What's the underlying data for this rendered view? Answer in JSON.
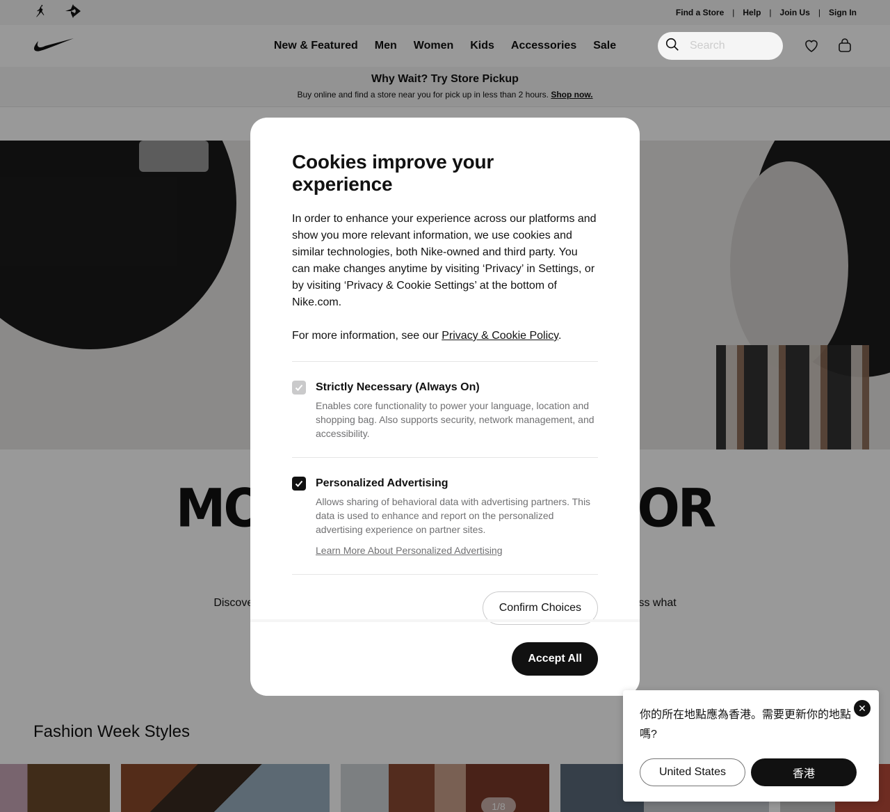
{
  "utility_bar": {
    "links": [
      "Find a Store",
      "Help",
      "Join Us",
      "Sign In"
    ],
    "separator": "|"
  },
  "nav": {
    "logo": "nike-swoosh-icon",
    "items": [
      "New & Featured",
      "Men",
      "Women",
      "Kids",
      "Accessories",
      "Sale"
    ],
    "search_placeholder": "Search"
  },
  "promo": {
    "title": "Why Wait? Try Store Pickup",
    "text": "Buy online and find a store near you for pick up in less than 2 hours.",
    "link": "Shop now."
  },
  "hero": {
    "headline_left": "MOV",
    "headline_right": "FOR",
    "sub_left": "Discover",
    "sub_right": "ess what"
  },
  "fashion": {
    "title": "Fashion Week Styles",
    "counter": "1/8"
  },
  "cookie_modal": {
    "title": "Cookies improve your experience",
    "body": "In order to enhance your experience across our platforms and show you more relevant information, we use cookies and similar technologies, both Nike-owned and third party. You can make changes anytime by visiting ‘Privacy’ in Settings, or by visiting ‘Privacy & Cookie Settings’ at the bottom of Nike.com.",
    "more_info_prefix": "For more information, see our ",
    "policy_link": "Privacy & Cookie Policy",
    "more_info_suffix": ".",
    "options": [
      {
        "title": "Strictly Necessary (Always On)",
        "description": "Enables core functionality to power your language, location and shopping bag. Also supports security, network management, and accessibility.",
        "checked": true,
        "disabled": true
      },
      {
        "title": "Personalized Advertising",
        "description": "Allows sharing of behavioral data with advertising partners. This data is used to enhance and report on the personalized advertising experience on partner sites.",
        "link": "Learn More About Personalized Advertising",
        "checked": true,
        "disabled": false
      }
    ],
    "confirm_button": "Confirm Choices",
    "accept_button": "Accept All"
  },
  "location_popup": {
    "text": "你的所在地點應為香港。需要更新你的地點嗎?",
    "button_stay": "United States",
    "button_switch": "香港"
  }
}
